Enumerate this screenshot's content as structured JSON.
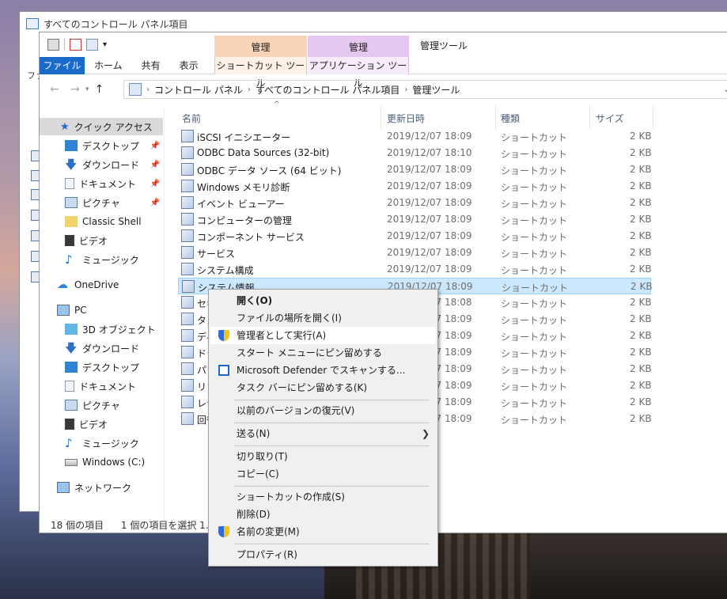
{
  "back_window": {
    "title": "すべてのコントロール パネル項目",
    "side_text": "ファ"
  },
  "window": {
    "title": "管理ツール",
    "context_tabs": [
      {
        "group": "管理",
        "tab": "ショートカット ツール"
      },
      {
        "group": "管理",
        "tab": "アプリケーション ツール"
      }
    ],
    "ribbon_tabs": [
      "ファイル",
      "ホーム",
      "共有",
      "表示"
    ]
  },
  "address": {
    "crumbs": [
      "コントロール パネル",
      "すべてのコントロール パネル項目",
      "管理ツール"
    ]
  },
  "sidebar": {
    "quick_access": "クイック アクセス",
    "quick_items": [
      "デスクトップ",
      "ダウンロード",
      "ドキュメント",
      "ピクチャ",
      "Classic Shell",
      "ビデオ",
      "ミュージック"
    ],
    "onedrive": "OneDrive",
    "pc": "PC",
    "pc_items": [
      "3D オブジェクト",
      "ダウンロード",
      "デスクトップ",
      "ドキュメント",
      "ピクチャ",
      "ビデオ",
      "ミュージック",
      "Windows (C:)"
    ],
    "network": "ネットワーク"
  },
  "columns": {
    "name": "名前",
    "date": "更新日時",
    "type": "種類",
    "size": "サイズ"
  },
  "files": [
    {
      "name": "iSCSI イニシエーター",
      "date": "2019/12/07 18:09",
      "type": "ショートカット",
      "size": "2 KB"
    },
    {
      "name": "ODBC Data Sources (32-bit)",
      "date": "2019/12/07 18:10",
      "type": "ショートカット",
      "size": "2 KB"
    },
    {
      "name": "ODBC データ ソース (64 ビット)",
      "date": "2019/12/07 18:09",
      "type": "ショートカット",
      "size": "2 KB"
    },
    {
      "name": "Windows メモリ診断",
      "date": "2019/12/07 18:09",
      "type": "ショートカット",
      "size": "2 KB"
    },
    {
      "name": "イベント ビューアー",
      "date": "2019/12/07 18:09",
      "type": "ショートカット",
      "size": "2 KB"
    },
    {
      "name": "コンピューターの管理",
      "date": "2019/12/07 18:09",
      "type": "ショートカット",
      "size": "2 KB"
    },
    {
      "name": "コンポーネント サービス",
      "date": "2019/12/07 18:09",
      "type": "ショートカット",
      "size": "2 KB"
    },
    {
      "name": "サービス",
      "date": "2019/12/07 18:09",
      "type": "ショートカット",
      "size": "2 KB"
    },
    {
      "name": "システム構成",
      "date": "2019/12/07 18:09",
      "type": "ショートカット",
      "size": "2 KB"
    },
    {
      "name": "システム情報",
      "date": "2019/12/07 18:09",
      "type": "ショートカット",
      "size": "2 KB"
    },
    {
      "name": "セキ",
      "date": "2019/12/07 18:08",
      "type": "ショートカット",
      "size": "2 KB"
    },
    {
      "name": "タス",
      "date": "2019/12/07 18:09",
      "type": "ショートカット",
      "size": "2 KB"
    },
    {
      "name": "ディ",
      "date": "2019/12/07 18:09",
      "type": "ショートカット",
      "size": "2 KB"
    },
    {
      "name": "ドラ",
      "date": "2019/12/07 18:09",
      "type": "ショートカット",
      "size": "2 KB"
    },
    {
      "name": "パフ",
      "date": "2019/12/07 18:09",
      "type": "ショートカット",
      "size": "2 KB"
    },
    {
      "name": "リソ",
      "date": "2019/12/07 18:09",
      "type": "ショートカット",
      "size": "2 KB"
    },
    {
      "name": "レジ",
      "date": "2019/12/07 18:09",
      "type": "ショートカット",
      "size": "2 KB"
    },
    {
      "name": "回復",
      "date": "2019/12/07 18:09",
      "type": "ショートカット",
      "size": "2 KB"
    }
  ],
  "status": {
    "count": "18 個の項目",
    "selected": "1 個の項目を選択  1.08"
  },
  "context_menu": {
    "items": [
      "開く(O)",
      "ファイルの場所を開く(I)",
      "管理者として実行(A)",
      "スタート メニューにピン留めする",
      "Microsoft Defender でスキャンする...",
      "タスク バーにピン留めする(K)",
      "以前のバージョンの復元(V)",
      "送る(N)",
      "切り取り(T)",
      "コピー(C)",
      "ショートカットの作成(S)",
      "削除(D)",
      "名前の変更(M)",
      "プロパティ(R)"
    ],
    "submenu_arrow": "❯"
  },
  "colors": {
    "accent": "#1b6ac9",
    "selection": "#cce8ff",
    "context_tab_1": "#f9d4b8",
    "context_tab_2": "#e6c7ef"
  }
}
